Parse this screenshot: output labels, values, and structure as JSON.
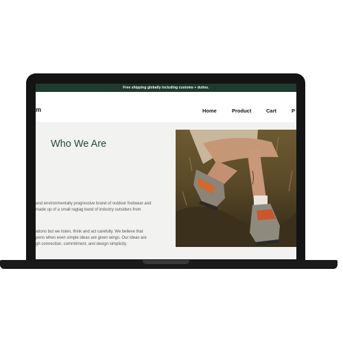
{
  "announcement": "Free shipping globally including customs + duties.",
  "brand": {
    "logo_text": "m"
  },
  "nav": {
    "items": [
      {
        "label": "Home"
      },
      {
        "label": "Product"
      },
      {
        "label": "Cart"
      },
      {
        "label": "P"
      }
    ]
  },
  "hero": {
    "title": "Who We Are",
    "paragraph1": [
      "and environmentally progressive brand of outdoor footwear and",
      "made up of a small ragtag band of industry outsiders from"
    ],
    "paragraph2": [
      "ations but we listen, think and act carefully. We believe that",
      "pens when even simple ideas are given wings. Our ideas are",
      "gh connection, commitment, and design simplicity."
    ]
  },
  "image": {
    "subject": "hiker boots on trail"
  },
  "colors": {
    "announcement_bg": "#1f3a2e",
    "title": "#24473a",
    "laptop": "#141414"
  }
}
